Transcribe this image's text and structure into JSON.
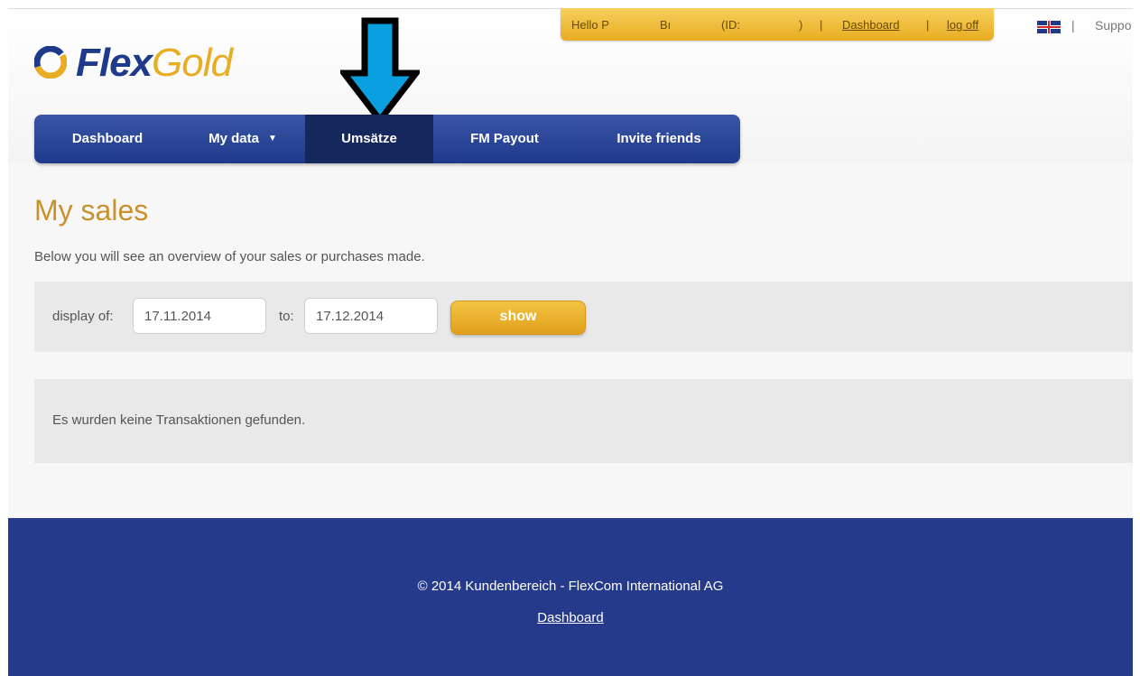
{
  "user_bar": {
    "greeting": "Hello P",
    "name_fragment": "Bı",
    "id_label": "(ID:",
    "id_close": ")",
    "separator": "|",
    "dashboard_link": "Dashboard",
    "logoff_link": "log off"
  },
  "top_right": {
    "separator": "|",
    "support_link": "Suppo"
  },
  "logo": {
    "flex": "Flex",
    "gold": "Gold"
  },
  "nav": {
    "items": [
      {
        "label": "Dashboard"
      },
      {
        "label": "My data"
      },
      {
        "label": "Umsätze"
      },
      {
        "label": "FM Payout"
      },
      {
        "label": "Invite friends"
      }
    ],
    "caret": "▼"
  },
  "main": {
    "title": "My sales",
    "intro": "Below you will see an overview of your sales or purchases made."
  },
  "filter": {
    "from_label": "display of:",
    "from_value": "17.11.2014",
    "to_label": "to:",
    "to_value": "17.12.2014",
    "show_button": "show"
  },
  "results": {
    "empty_message": "Es wurden keine Transaktionen gefunden."
  },
  "footer": {
    "copyright": "© 2014 Kundenbereich - FlexCom International AG",
    "dashboard_link": "Dashboard"
  },
  "colors": {
    "brand_blue": "#1f3a8a",
    "brand_gold": "#e8ad23",
    "footer_blue": "#253a8a",
    "title_gold": "#c9912c",
    "arrow_blue": "#0aa0e0"
  }
}
